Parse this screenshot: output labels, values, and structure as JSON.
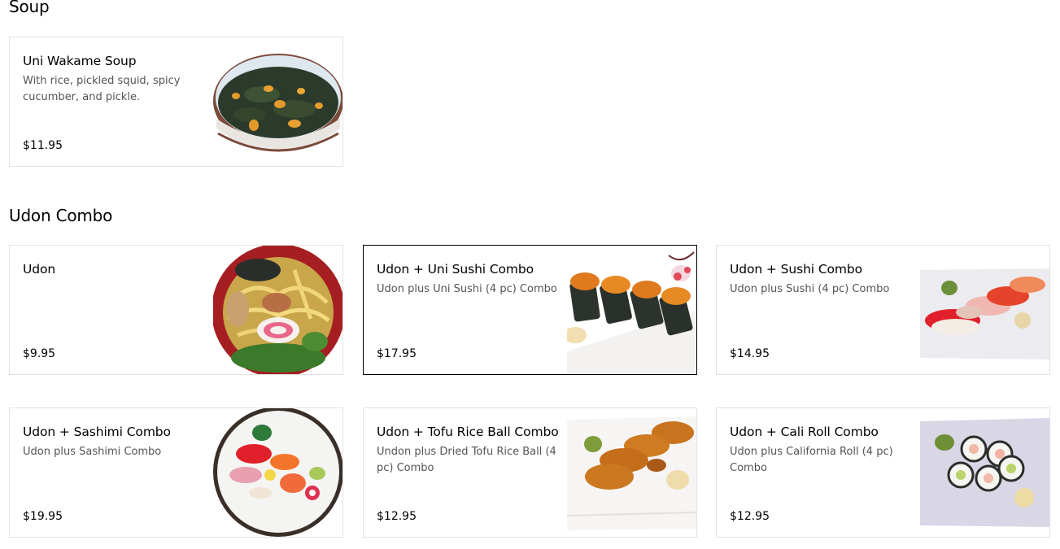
{
  "sections": [
    {
      "title": "Soup",
      "items": [
        {
          "name": "Uni Wakame Soup",
          "description": "With rice, pickled squid, spicy cucumber, and pickle.",
          "price": "$11.95",
          "image": "uni-wakame-soup-photo"
        }
      ]
    },
    {
      "title": "Udon Combo",
      "items": [
        {
          "name": "Udon",
          "description": "",
          "price": "$9.95",
          "image": "udon-photo"
        },
        {
          "name": "Udon + Uni Sushi Combo",
          "description": "Udon plus Uni Sushi (4 pc) Combo",
          "price": "$17.95",
          "image": "uni-sushi-photo",
          "selected": true
        },
        {
          "name": "Udon + Sushi Combo",
          "description": "Udon plus Sushi (4 pc) Combo",
          "price": "$14.95",
          "image": "sushi-photo"
        },
        {
          "name": "Udon + Sashimi Combo",
          "description": "Udon plus Sashimi Combo",
          "price": "$19.95",
          "image": "sashimi-photo"
        },
        {
          "name": "Udon + Tofu Rice Ball Combo",
          "description": "Undon plus Dried Tofu Rice Ball (4 pc) Combo",
          "price": "$12.95",
          "image": "inari-photo"
        },
        {
          "name": "Udon + Cali Roll Combo",
          "description": "Udon plus California Roll (4 pc) Combo",
          "price": "$12.95",
          "image": "california-roll-photo"
        }
      ]
    }
  ]
}
